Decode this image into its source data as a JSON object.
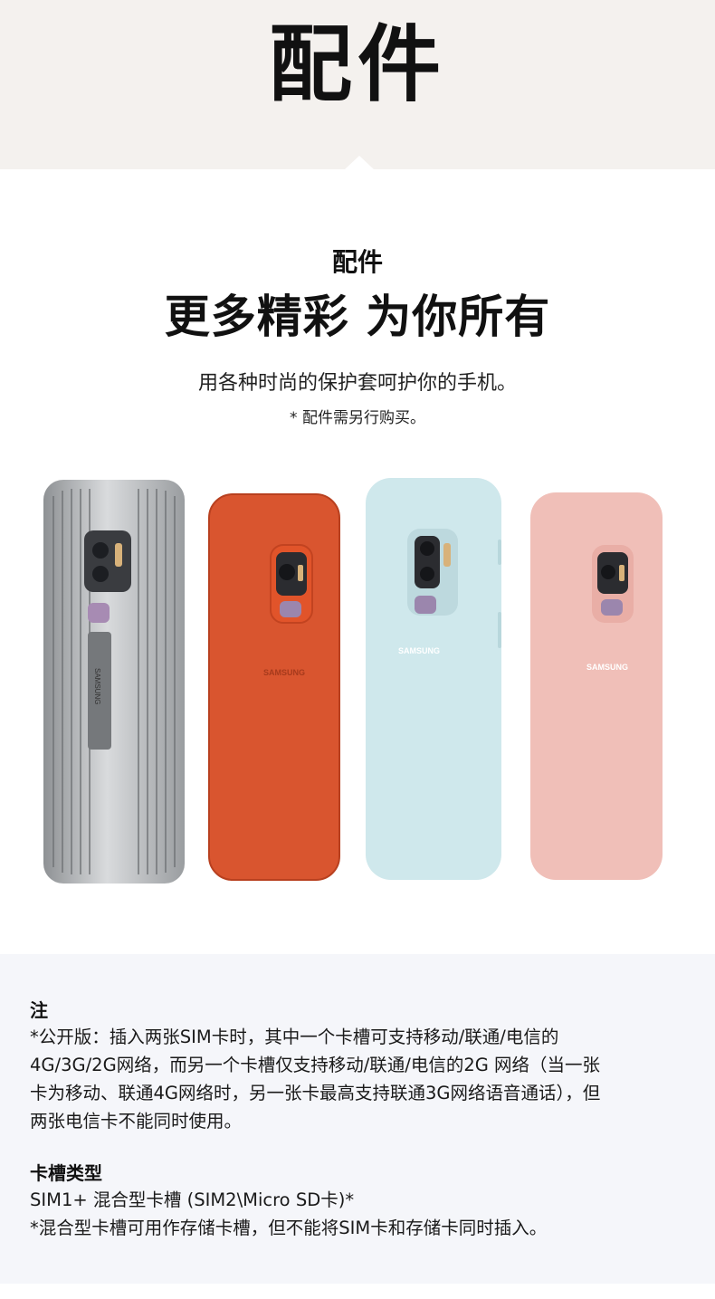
{
  "banner": {
    "title": "配件"
  },
  "hero": {
    "eyebrow": "配件",
    "title": "更多精彩 为你所有",
    "description": "用各种时尚的保护套呵护你的手机。",
    "note": "* 配件需另行购买。"
  },
  "cases": [
    {
      "name": "silver-standing-cover",
      "brand": "SAMSUNG",
      "color": "#b9bcbf"
    },
    {
      "name": "red-alcantara-cover",
      "brand": "SAMSUNG",
      "color": "#d9552f"
    },
    {
      "name": "blue-silicone-cover",
      "brand": "SAMSUNG",
      "color": "#cfe8ec"
    },
    {
      "name": "pink-silicone-cover",
      "brand": "SAMSUNG",
      "color": "#f0bfb8"
    }
  ],
  "notes": {
    "section1": {
      "heading": "注",
      "lines": [
        "*公开版：插入两张SIM卡时，其中一个卡槽可支持移动/联通/电信的",
        "4G/3G/2G网络，而另一个卡槽仅支持移动/联通/电信的2G 网络（当一张",
        "卡为移动、联通4G网络时，另一张卡最高支持联通3G网络语音通话），但",
        "两张电信卡不能同时使用。"
      ]
    },
    "section2": {
      "heading": "卡槽类型",
      "lines": [
        "SIM1+ 混合型卡槽 (SIM2\\Micro SD卡)*",
        "*混合型卡槽可用作存储卡槽，但不能将SIM卡和存储卡同时插入。"
      ]
    }
  },
  "colors": {
    "banner_bg": "#f4f1ee",
    "notes_bg": "#f5f6fa",
    "text": "#111111"
  }
}
